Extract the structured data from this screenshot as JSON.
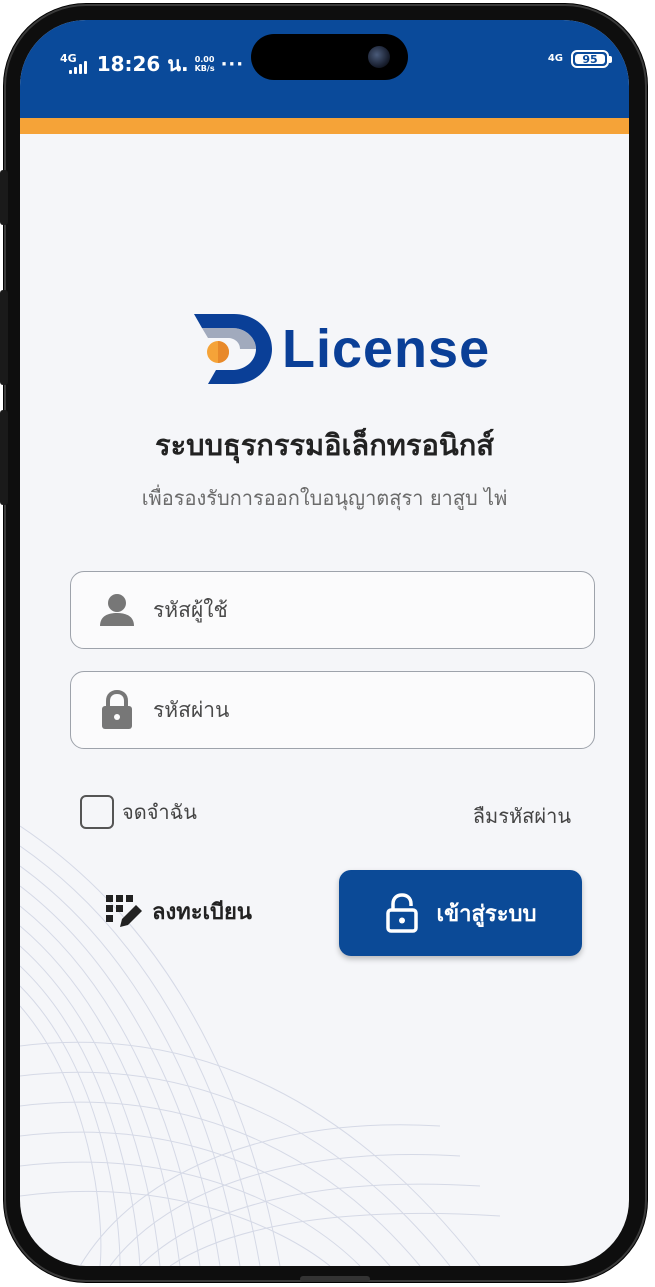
{
  "status_bar": {
    "network": "4G",
    "time": "18:26 น.",
    "speed_value": "0.00",
    "speed_unit": "KB/s",
    "dots": "···",
    "network_right": "4G",
    "battery": "95"
  },
  "app": {
    "logo_text": "License",
    "title": "ระบบธุรกรรมอิเล็กทรอนิกส์",
    "subtitle": "เพื่อรองรับการออกใบอนุญาตสุรา ยาสูบ ไพ่"
  },
  "form": {
    "username_placeholder": "รหัสผู้ใช้",
    "password_placeholder": "รหัสผ่าน",
    "remember_label": "จดจำฉัน",
    "remember_checked": false,
    "forgot_label": "ลืมรหัสผ่าน",
    "register_label": "ลงทะเบียน",
    "login_label": "เข้าสู่ระบบ"
  },
  "icons": {
    "user": "user-icon",
    "lock": "lock-icon",
    "register": "register-icon",
    "login": "unlock-icon"
  },
  "colors": {
    "primary": "#0a4a9a",
    "accent": "#f5a338",
    "logo_orange": "#f5a338",
    "logo_blue": "#0a3f97"
  }
}
